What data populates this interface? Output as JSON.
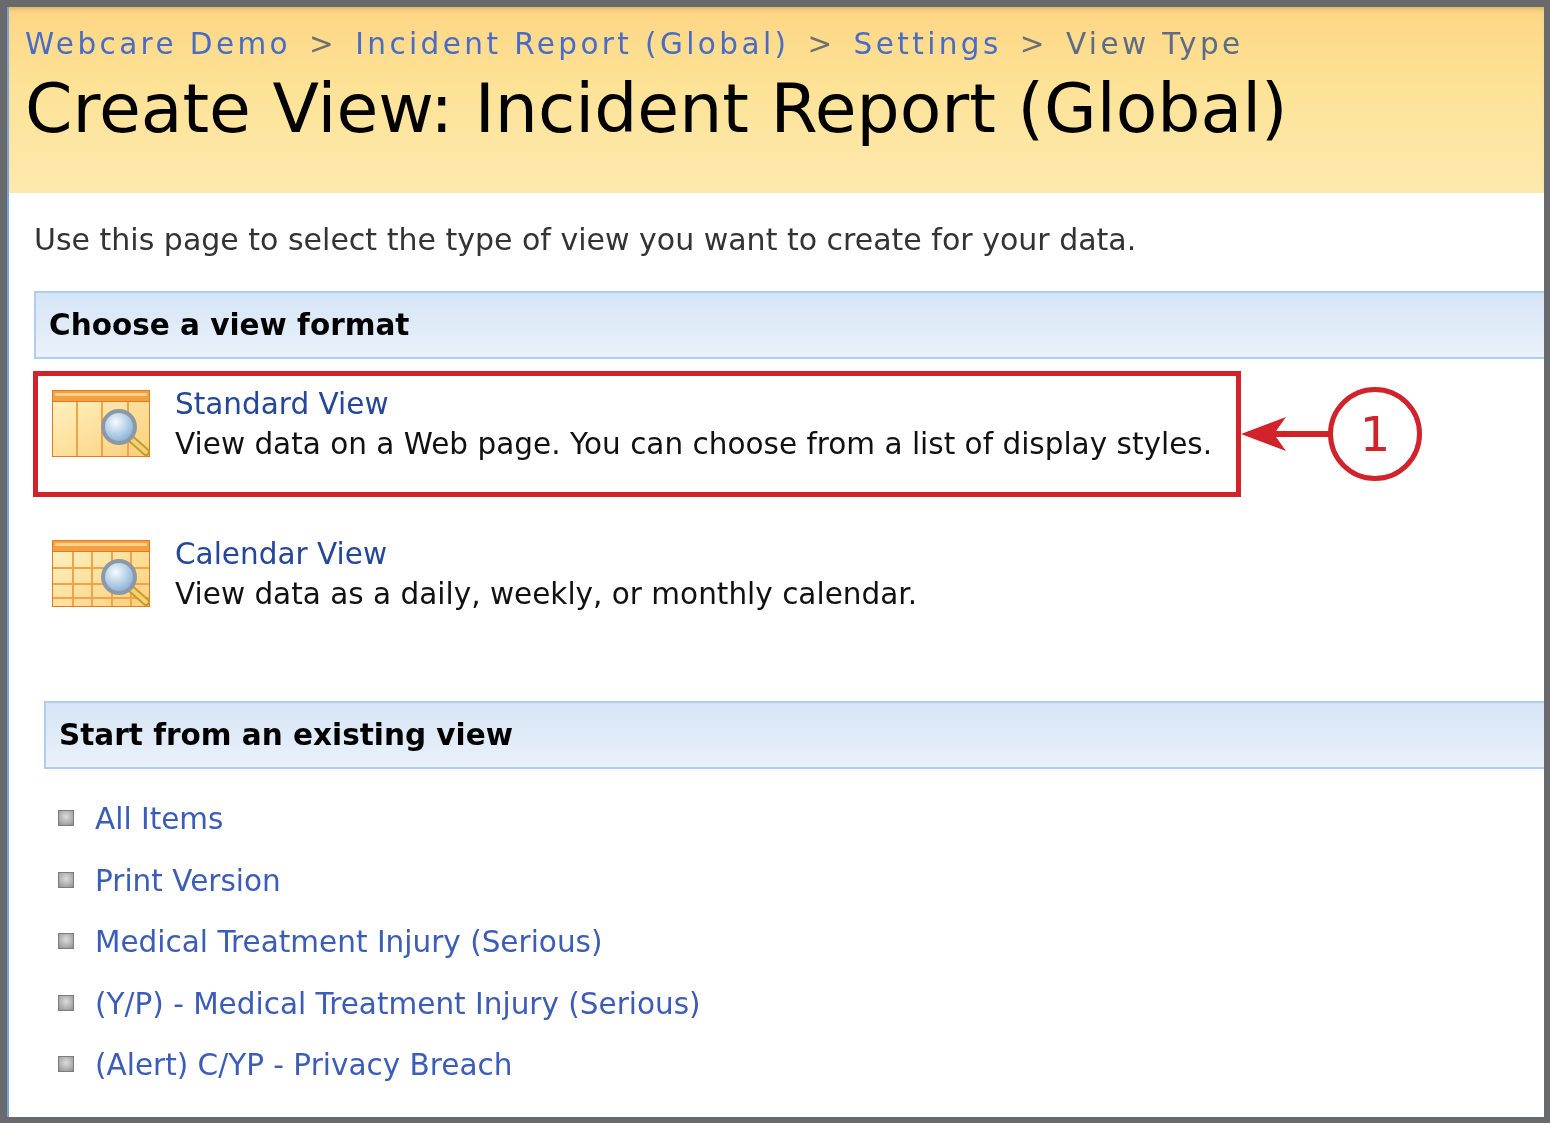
{
  "breadcrumb": [
    {
      "label": "Webcare Demo",
      "kind": "link",
      "separator": ">"
    },
    {
      "label": "Incident Report (Global)",
      "kind": "link",
      "separator": ">"
    },
    {
      "label": "Settings",
      "kind": "link",
      "separator": ">"
    },
    {
      "label": "View Type",
      "kind": "current"
    }
  ],
  "title": "Create View: Incident Report (Global)",
  "intro": "Use this page to select the type of view you want to create for your data.",
  "sections": [
    {
      "kind": "formats",
      "heading": "Choose a view format",
      "options": [
        {
          "kind": "standard",
          "name": "Standard View",
          "description": "View data on a Web page. You can choose from a list of display styles.",
          "highlighted": true,
          "callout": "1"
        },
        {
          "kind": "calendar",
          "name": "Calendar View",
          "description": "View data as a daily, weekly, or monthly calendar.",
          "highlighted": false
        }
      ]
    },
    {
      "kind": "views",
      "heading": "Start from an existing view",
      "items": [
        "All Items",
        "Print Version",
        "Medical Treatment Injury (Serious)",
        "(Y/P) - Medical Treatment Injury (Serious)",
        "(Alert) C/YP - Privacy Breach"
      ]
    }
  ]
}
